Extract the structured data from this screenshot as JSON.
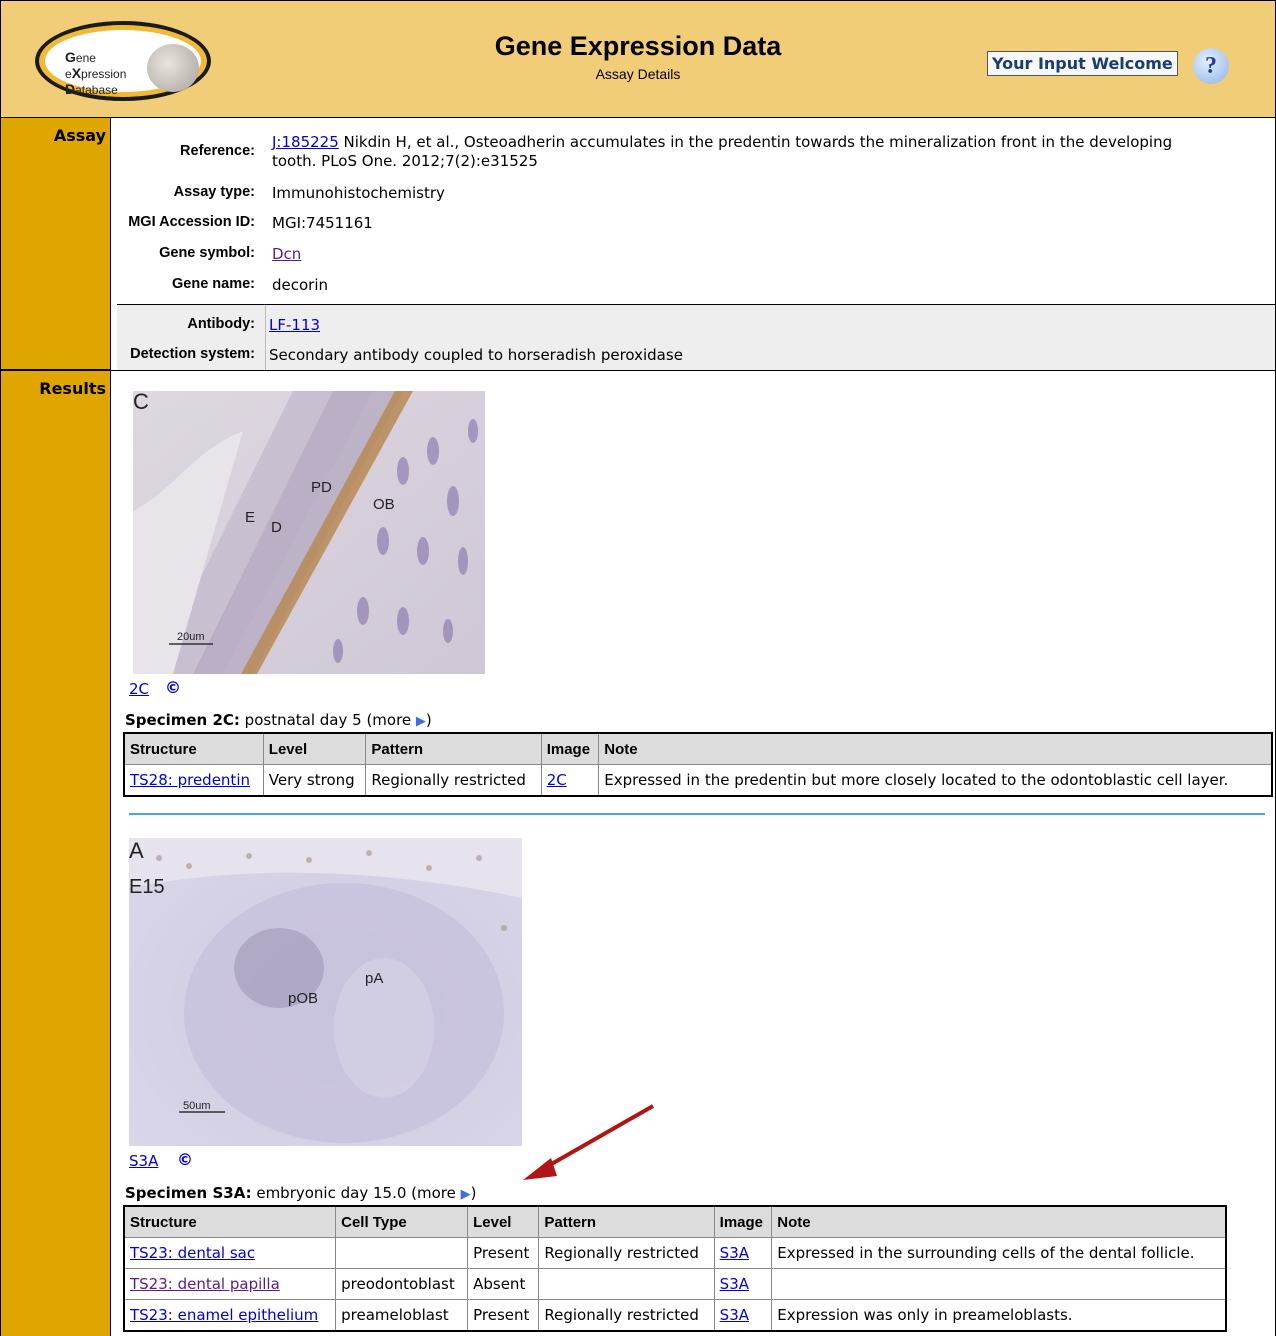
{
  "header": {
    "logo": {
      "line1_cap": "G",
      "line1": "ene",
      "line2_pre": "e",
      "line2_cap": "X",
      "line2": "pression",
      "line3_cap": "D",
      "line3": "atabase"
    },
    "title": "Gene Expression Data",
    "subtitle": "Assay Details",
    "input_button": "Your Input Welcome",
    "help_glyph": "?"
  },
  "assay": {
    "section_label": "Assay",
    "reference_label": "Reference:",
    "reference_id": "J:185225",
    "reference_line1": " Nikdin H, et al., Osteoadherin accumulates in the predentin towards the mineralization front in the developing",
    "reference_line2": "tooth. PLoS One. 2012;7(2):e31525",
    "assay_type_label": "Assay type:",
    "assay_type": "Immunohistochemistry",
    "accession_label": "MGI Accession ID:",
    "accession": "MGI:7451161",
    "gene_symbol_label": "Gene symbol:",
    "gene_symbol": "Dcn",
    "gene_name_label": "Gene name:",
    "gene_name": "decorin",
    "antibody_label": "Antibody:",
    "antibody": "LF-113",
    "detection_label": "Detection system:",
    "detection": "Secondary antibody coupled to horseradish peroxidase"
  },
  "results": {
    "section_label": "Results",
    "specimen1": {
      "image_labels": {
        "c": "C",
        "e": "E",
        "d": "D",
        "pd": "PD",
        "ob": "OB",
        "scale": "20um"
      },
      "image_link": "2C",
      "copyright": "©",
      "title_bold": "Specimen 2C:",
      "title_rest": " postnatal day 5 (more ",
      "title_end": ")",
      "headers": [
        "Structure",
        "Level",
        "Pattern",
        "Image",
        "Note"
      ],
      "row": {
        "structure": "TS28: predentin",
        "level": "Very strong",
        "pattern": "Regionally restricted",
        "image": "2C",
        "note": "Expressed in the predentin but more closely located to the odontoblastic cell layer."
      }
    },
    "specimen2": {
      "image_labels": {
        "a": "A",
        "stage": "E15",
        "poB": "pOB",
        "pa": "pA",
        "scale": "50um"
      },
      "image_link": "S3A",
      "copyright": "©",
      "title_bold": "Specimen S3A:",
      "title_rest": " embryonic day 15.0 (more ",
      "title_end": ")",
      "headers": [
        "Structure",
        "Cell Type",
        "Level",
        "Pattern",
        "Image",
        "Note"
      ],
      "rows": [
        {
          "structure": "TS23: dental sac",
          "cell_type": "",
          "level": "Present",
          "pattern": "Regionally restricted",
          "image": "S3A",
          "note": "Expressed in the surrounding cells of the dental follicle."
        },
        {
          "structure": "TS23: dental papilla",
          "cell_type": "preodontoblast",
          "level": "Absent",
          "pattern": "",
          "image": "S3A",
          "note": ""
        },
        {
          "structure": "TS23: enamel epithelium",
          "cell_type": "preameloblast",
          "level": "Present",
          "pattern": "Regionally restricted",
          "image": "S3A",
          "note": "Expression was only in preameloblasts."
        }
      ]
    }
  },
  "colors": {
    "header_bg": "#f1cd77",
    "side_bg": "#e0a600",
    "link": "#0000d8",
    "annotation_arrow": "#b01414"
  }
}
